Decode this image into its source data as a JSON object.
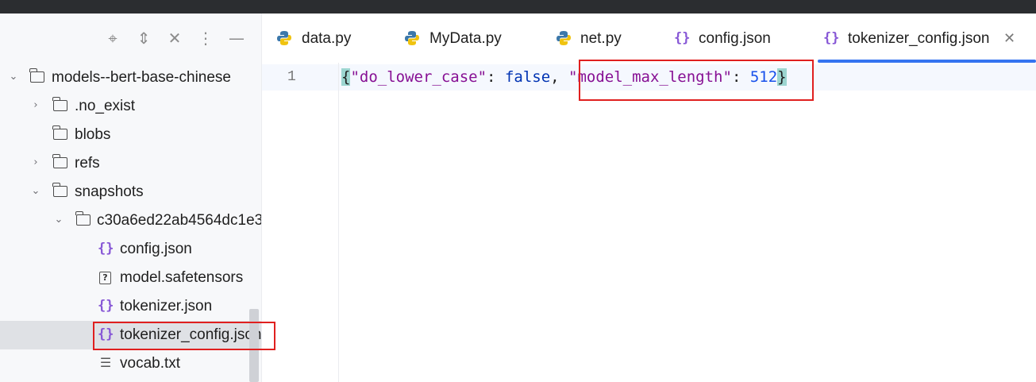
{
  "sidebar": {
    "toolbar_icons": [
      "crosshair-icon",
      "expand-all-icon",
      "collapse-all-icon",
      "more-options-icon",
      "minimize-icon"
    ],
    "tree": [
      {
        "label": "models--bert-base-chinese",
        "type": "folder",
        "expanded": true
      },
      {
        "label": ".no_exist",
        "type": "folder",
        "expanded": false
      },
      {
        "label": "blobs",
        "type": "folder"
      },
      {
        "label": "refs",
        "type": "folder",
        "expanded": false
      },
      {
        "label": "snapshots",
        "type": "folder",
        "expanded": true
      },
      {
        "label": "c30a6ed22ab4564dc1e3",
        "type": "folder",
        "expanded": true
      },
      {
        "label": "config.json",
        "type": "json-file"
      },
      {
        "label": "model.safetensors",
        "type": "unknown-file"
      },
      {
        "label": "tokenizer.json",
        "type": "json-file"
      },
      {
        "label": "tokenizer_config.json",
        "type": "json-file",
        "selected": true
      },
      {
        "label": "vocab.txt",
        "type": "text-file"
      }
    ]
  },
  "editor": {
    "tabs": [
      {
        "label": "data.py",
        "icon": "python-icon"
      },
      {
        "label": "MyData.py",
        "icon": "python-icon"
      },
      {
        "label": "net.py",
        "icon": "python-icon"
      },
      {
        "label": "config.json",
        "icon": "json-icon"
      },
      {
        "label": "tokenizer_config.json",
        "icon": "json-icon",
        "active": true
      }
    ],
    "line_number": "1",
    "code": {
      "open_brace": "{",
      "key1": "\"do_lower_case\"",
      "sep1": ": ",
      "val1": "false",
      "comma": ", ",
      "key2": "\"model_max_length\"",
      "sep2": ": ",
      "val2": "512",
      "close_brace": "}"
    }
  },
  "colors": {
    "accent": "#3574f0",
    "highlight_box": "#e0201f",
    "json_icon": "#8757d6",
    "string": "#871094",
    "keyword": "#0033b3",
    "number": "#1750eb"
  }
}
